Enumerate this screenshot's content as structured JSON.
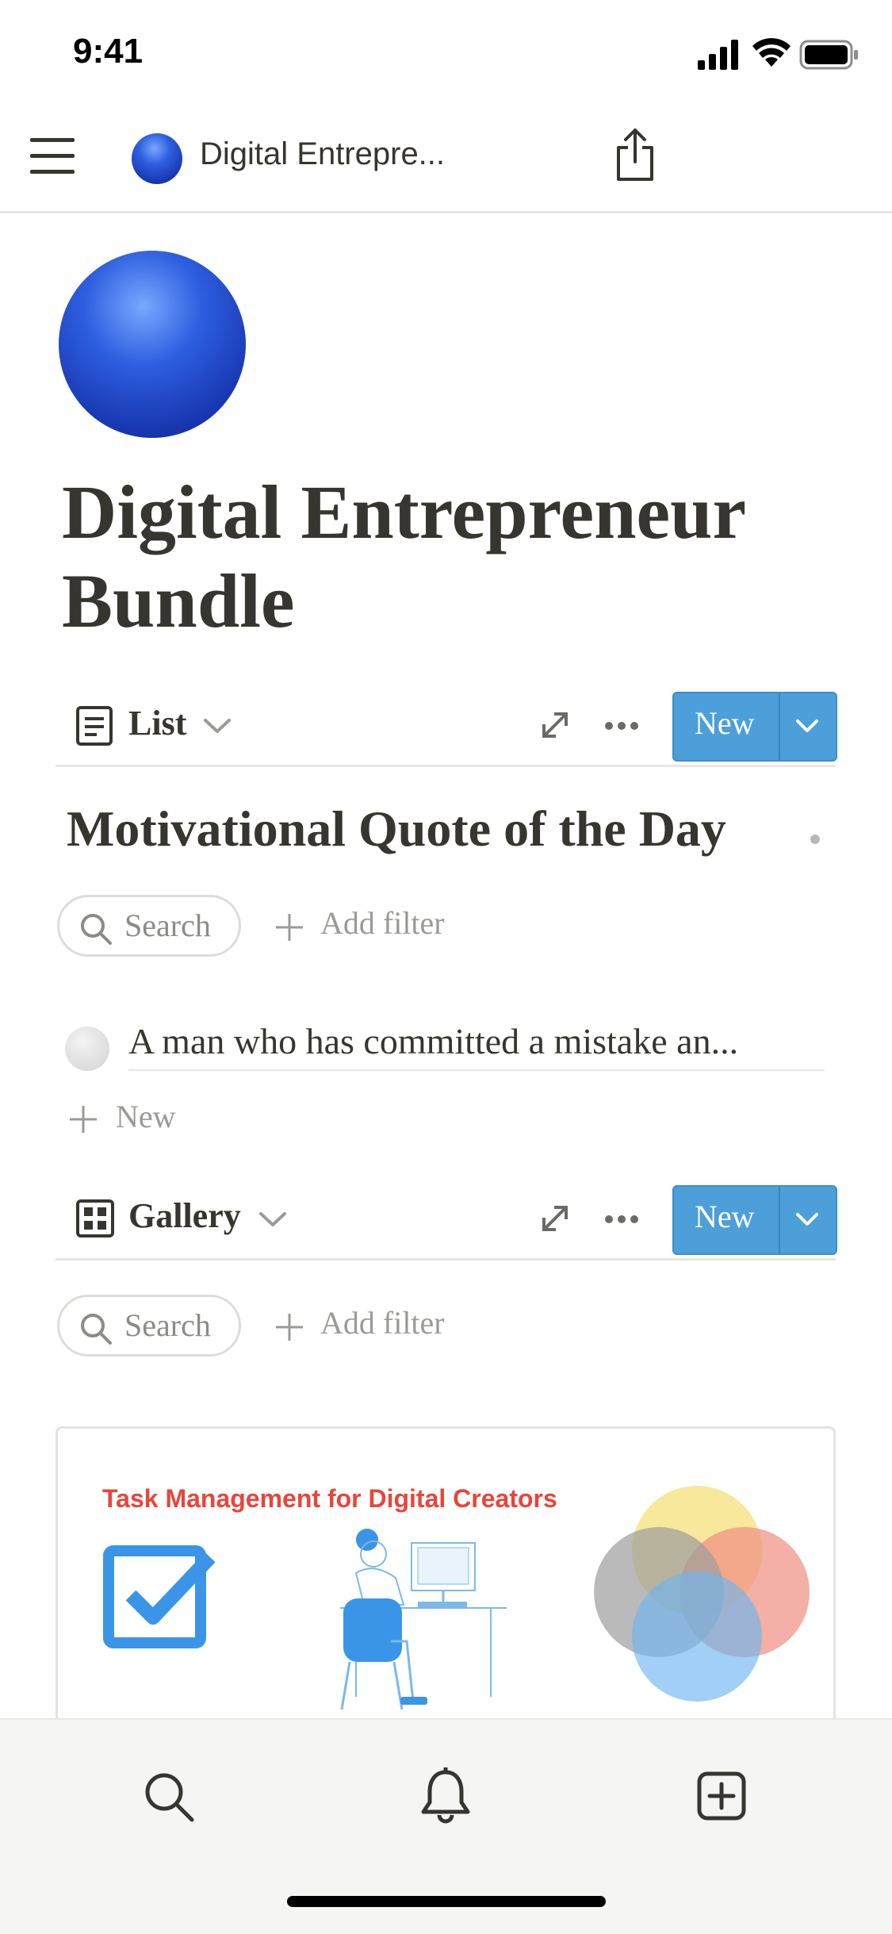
{
  "status_bar": {
    "time": "9:41"
  },
  "nav": {
    "title": "Digital Entrepre..."
  },
  "page": {
    "title": "Digital Entrepreneur Bundle"
  },
  "list_view": {
    "view_name": "List",
    "new_label": "New",
    "section_heading": "Motivational Quote of the Day",
    "search_label": "Search",
    "add_filter_label": "Add filter",
    "items": [
      {
        "text": "A man who has committed a mistake an..."
      }
    ],
    "add_new_label": "New"
  },
  "gallery_view": {
    "view_name": "Gallery",
    "new_label": "New",
    "search_label": "Search",
    "add_filter_label": "Add filter",
    "cards": [
      {
        "cover_title": "Task Management for Digital Creators"
      }
    ]
  },
  "colors": {
    "accent_blue": "#4d9fd9",
    "text": "#37352f",
    "cover_red": "#e8453c",
    "illustration_blue": "#3a95e8"
  },
  "icons": {
    "menu": "hamburger-menu-icon",
    "share": "share-icon",
    "list": "list-view-icon",
    "gallery": "gallery-view-icon",
    "expand": "expand-icon",
    "more": "more-icon",
    "search": "search-icon",
    "notifications": "bell-icon",
    "new_page": "new-page-icon"
  }
}
